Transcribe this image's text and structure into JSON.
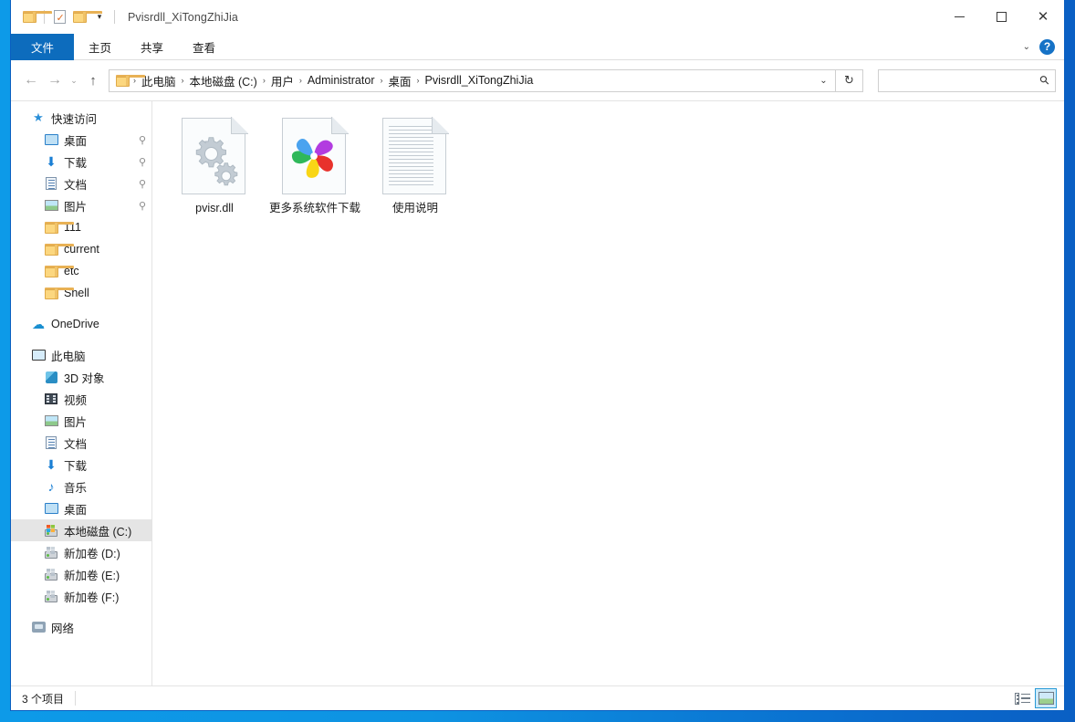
{
  "window": {
    "title": "Pvisrdll_XiTongZhiJia",
    "minimize_label": "最小化",
    "maximize_label": "最大化",
    "close_label": "关闭",
    "close_glyph": "✕"
  },
  "quick_access_toolbar": {
    "items": [
      {
        "name": "folder-icon",
        "label": "属性"
      },
      {
        "name": "properties-icon",
        "label": "属性"
      },
      {
        "name": "new-folder-icon",
        "label": "新建文件夹"
      }
    ],
    "customize_glyph": "▾"
  },
  "ribbon": {
    "tabs": [
      {
        "label": "文件",
        "active": true
      },
      {
        "label": "主页",
        "active": false
      },
      {
        "label": "共享",
        "active": false
      },
      {
        "label": "查看",
        "active": false
      }
    ],
    "expand_glyph": "⌄",
    "help_glyph": "?"
  },
  "navbar": {
    "back_glyph": "←",
    "forward_glyph": "→",
    "recent_glyph": "⌄",
    "up_glyph": "↑",
    "refresh_glyph": "↻",
    "address_dropdown_glyph": "⌄",
    "breadcrumbs": [
      "此电脑",
      "本地磁盘 (C:)",
      "用户",
      "Administrator",
      "桌面",
      "Pvisrdll_XiTongZhiJia"
    ],
    "crumb_separator": "›"
  },
  "search": {
    "value": "",
    "placeholder": "",
    "icon_glyph": "⚲"
  },
  "sidebar": {
    "groups": [
      {
        "header": {
          "label": "快速访问",
          "icon": "star-icon"
        },
        "items": [
          {
            "label": "桌面",
            "icon": "desktop-icon",
            "pinned": true,
            "level": 1
          },
          {
            "label": "下载",
            "icon": "downloads-icon",
            "pinned": true,
            "level": 1
          },
          {
            "label": "文档",
            "icon": "documents-icon",
            "pinned": true,
            "level": 1
          },
          {
            "label": "图片",
            "icon": "pictures-icon",
            "pinned": true,
            "level": 1
          },
          {
            "label": "111",
            "icon": "folder-icon",
            "pinned": false,
            "level": 1
          },
          {
            "label": "current",
            "icon": "folder-icon",
            "pinned": false,
            "level": 1
          },
          {
            "label": "etc",
            "icon": "folder-icon",
            "pinned": false,
            "level": 1
          },
          {
            "label": "Shell",
            "icon": "folder-icon",
            "pinned": false,
            "level": 1
          }
        ]
      },
      {
        "header": {
          "label": "OneDrive",
          "icon": "cloud-icon"
        },
        "items": []
      },
      {
        "header": {
          "label": "此电脑",
          "icon": "this-pc-icon"
        },
        "items": [
          {
            "label": "3D 对象",
            "icon": "3d-objects-icon",
            "pinned": false,
            "level": 1
          },
          {
            "label": "视频",
            "icon": "videos-icon",
            "pinned": false,
            "level": 1
          },
          {
            "label": "图片",
            "icon": "pictures-icon",
            "pinned": false,
            "level": 1
          },
          {
            "label": "文档",
            "icon": "documents-icon",
            "pinned": false,
            "level": 1
          },
          {
            "label": "下载",
            "icon": "downloads-icon",
            "pinned": false,
            "level": 1
          },
          {
            "label": "音乐",
            "icon": "music-icon",
            "pinned": false,
            "level": 1
          },
          {
            "label": "桌面",
            "icon": "desktop-icon",
            "pinned": false,
            "level": 1
          },
          {
            "label": "本地磁盘 (C:)",
            "icon": "drive-icon",
            "pinned": false,
            "level": 1,
            "selected": true
          },
          {
            "label": "新加卷 (D:)",
            "icon": "drive-icon",
            "pinned": false,
            "level": 1
          },
          {
            "label": "新加卷 (E:)",
            "icon": "drive-icon",
            "pinned": false,
            "level": 1
          },
          {
            "label": "新加卷 (F:)",
            "icon": "drive-icon",
            "pinned": false,
            "level": 1
          }
        ]
      },
      {
        "header": {
          "label": "网络",
          "icon": "network-icon"
        },
        "items": []
      }
    ],
    "pin_glyph": "📌"
  },
  "files": [
    {
      "name": "pvisr.dll",
      "icon": "gears-file-icon"
    },
    {
      "name": "更多系统软件下载",
      "icon": "pinwheel-file-icon"
    },
    {
      "name": "使用说明",
      "icon": "text-document-icon"
    }
  ],
  "statusbar": {
    "item_count_text": "3 个项目",
    "view_details_label": "详细信息",
    "view_large_icons_label": "大图标"
  },
  "colors": {
    "accent_blue": "#0d6cbd",
    "desktop_blue_left": "#0d9ae8",
    "desktop_blue_right": "#0a5fc4",
    "selection_gray": "#e5e5e5",
    "help_blue": "#1572c6"
  }
}
